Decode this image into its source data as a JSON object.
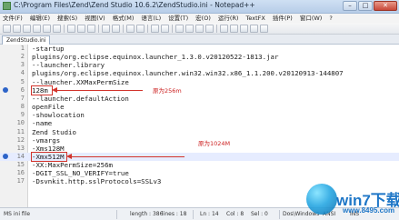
{
  "window": {
    "title": "C:\\Program Files\\Zend\\Zend Studio 10.6.2\\ZendStudio.ini - Notepad++",
    "controls": {
      "minimize": "–",
      "maximize": "□",
      "close": "✕"
    }
  },
  "menu": [
    "文件(F)",
    "编辑(E)",
    "搜索(S)",
    "视图(V)",
    "格式(M)",
    "语言(L)",
    "设置(T)",
    "宏(O)",
    "运行(R)",
    "TextFX",
    "插件(P)",
    "窗口(W)",
    "?"
  ],
  "tab": {
    "label": "ZendStudio.ini"
  },
  "editor": {
    "lines": [
      "-startup",
      "plugins/org.eclipse.equinox.launcher_1.3.0.v20120522-1813.jar",
      "--launcher.library",
      "plugins/org.eclipse.equinox.launcher.win32.win32.x86_1.1.200.v20120913-144807",
      "--launcher.XXMaxPermSize",
      "128m",
      "--launcher.defaultAction",
      "openFile",
      "-showlocation",
      "-name",
      "Zend Studio",
      "-vmargs",
      "-Xms128M",
      "-Xmx512M",
      "-XX:MaxPermSize=256m",
      "-DGIT_SSL_NO_VERIFY=true",
      "-Dsvnkit.http.sslProtocols=SSLv3"
    ]
  },
  "annotations": {
    "first": "原为256m",
    "second": "原为1024M"
  },
  "status": {
    "type": "MS ini file",
    "length": "length : 386",
    "lines": "lines : 18",
    "ln": "Ln : 14",
    "col": "Col : 8",
    "sel": "Sel : 0",
    "eol": "Dos\\Windows",
    "encoding": "ANSI",
    "mode": "INS"
  },
  "watermark": {
    "brand": "win7下载吧",
    "url": "www.8495.com"
  }
}
